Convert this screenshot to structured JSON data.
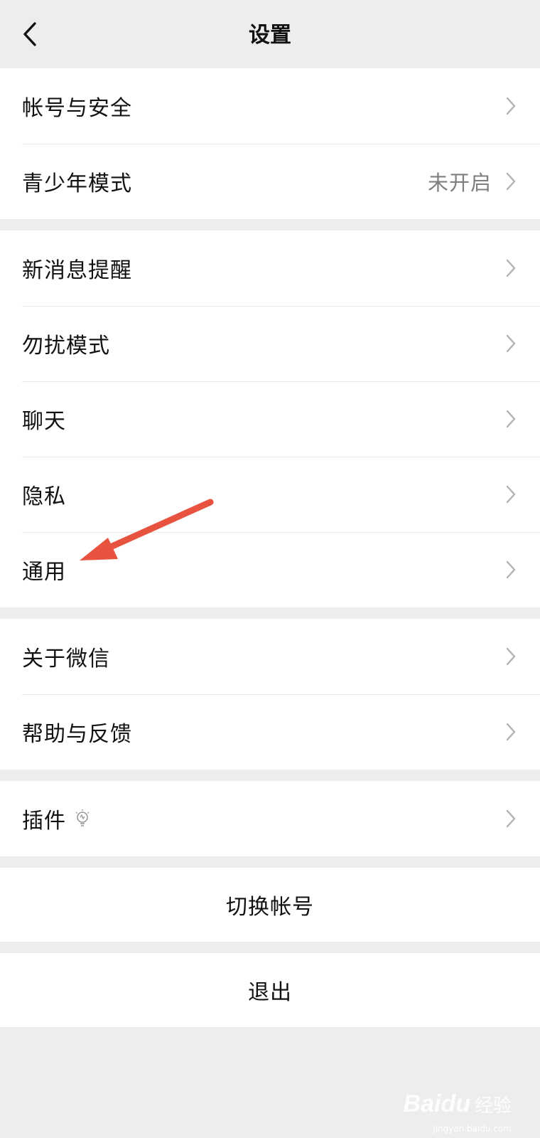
{
  "header": {
    "title": "设置",
    "back_icon": "chevron-left-icon"
  },
  "groups": [
    {
      "items": [
        {
          "label": "帐号与安全"
        },
        {
          "label": "青少年模式",
          "value": "未开启"
        }
      ]
    },
    {
      "items": [
        {
          "label": "新消息提醒"
        },
        {
          "label": "勿扰模式"
        },
        {
          "label": "聊天"
        },
        {
          "label": "隐私"
        },
        {
          "label": "通用"
        }
      ]
    },
    {
      "items": [
        {
          "label": "关于微信"
        },
        {
          "label": "帮助与反馈"
        }
      ]
    },
    {
      "items": [
        {
          "label": "插件",
          "icon": "lightbulb-icon"
        }
      ]
    }
  ],
  "actions": {
    "switch_account": "切换帐号",
    "logout": "退出"
  },
  "annotation": {
    "arrow_color": "#e8533f",
    "points_to": "通用"
  },
  "watermark": {
    "brand": "Baidu",
    "sub": "经验",
    "url": "jingyan.baidu.com"
  },
  "colors": {
    "background": "#ededed",
    "card": "#ffffff",
    "secondary_text": "#7f7f7f",
    "chevron": "#b2b2b2"
  }
}
